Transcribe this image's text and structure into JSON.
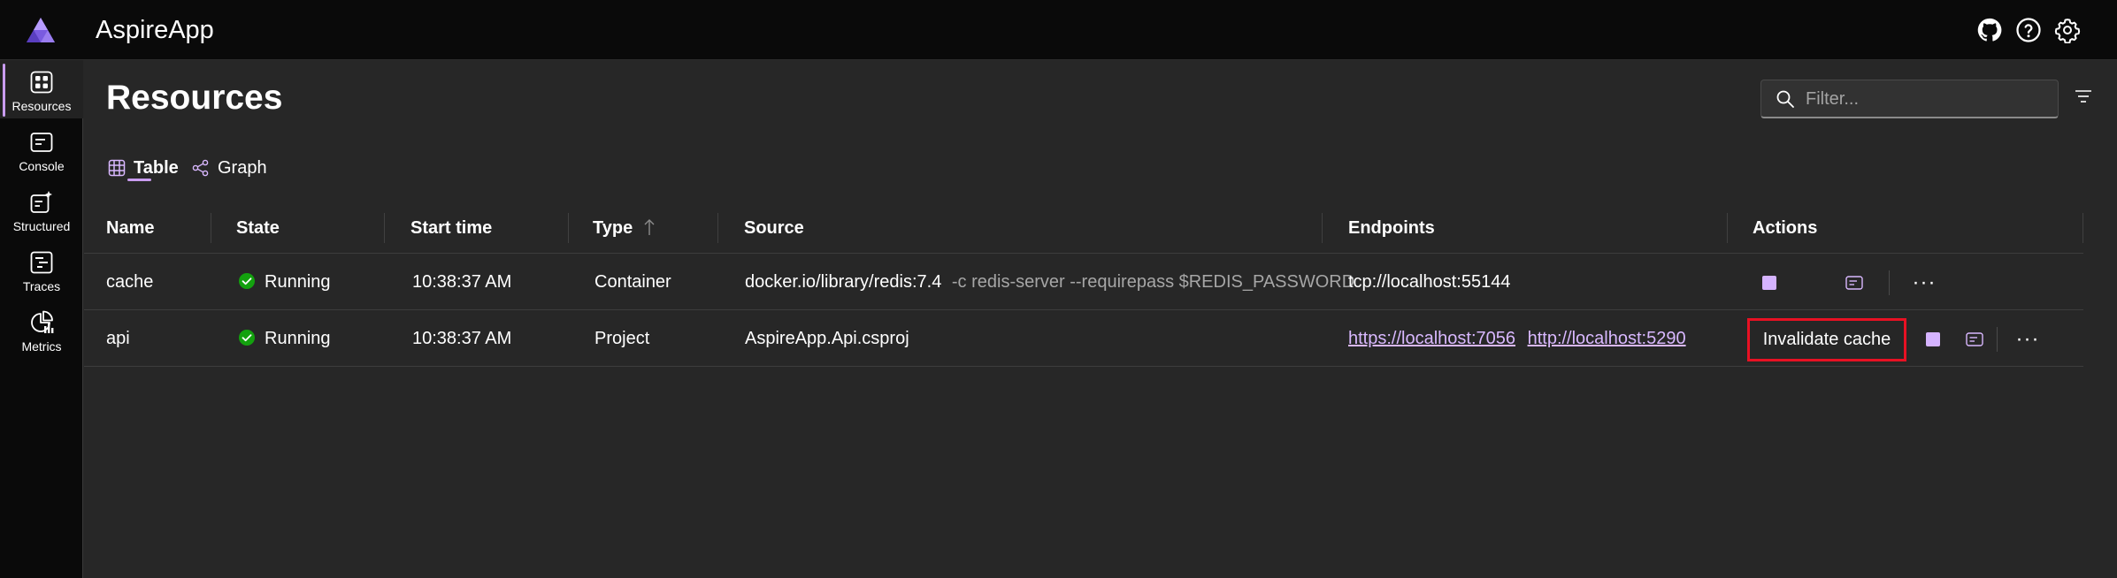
{
  "app": {
    "title": "AspireApp"
  },
  "header_icons": [
    "github-icon",
    "help-icon",
    "settings-icon"
  ],
  "nav": [
    {
      "id": "resources",
      "label": "Resources",
      "icon": "resources-icon",
      "active": true
    },
    {
      "id": "console",
      "label": "Console",
      "icon": "console-icon"
    },
    {
      "id": "structured",
      "label": "Structured",
      "icon": "structured-icon"
    },
    {
      "id": "traces",
      "label": "Traces",
      "icon": "traces-icon"
    },
    {
      "id": "metrics",
      "label": "Metrics",
      "icon": "metrics-icon"
    }
  ],
  "page": {
    "title": "Resources"
  },
  "filter": {
    "placeholder": "Filter..."
  },
  "tabs": [
    {
      "label": "Table",
      "active": true
    },
    {
      "label": "Graph"
    }
  ],
  "table": {
    "columns": [
      "Name",
      "State",
      "Start time",
      "Type",
      "Source",
      "Endpoints",
      "Actions"
    ],
    "rows": [
      {
        "name": "cache",
        "state": "Running",
        "start_time": "10:38:37 AM",
        "type": "Container",
        "source": "docker.io/library/redis:7.4",
        "source_args": "-c redis-server --requirepass $REDIS_PASSWORD",
        "endpoints": [
          "tcp://localhost:55144"
        ]
      },
      {
        "name": "api",
        "state": "Running",
        "start_time": "10:38:37 AM",
        "type": "Project",
        "source": "AspireApp.Api.csproj",
        "source_args": "",
        "endpoints": [
          "https://localhost:7056",
          "http://localhost:5290"
        ],
        "custom_action": "Invalidate cache"
      }
    ]
  },
  "colors": {
    "accent": "#c99cf0",
    "link": "#d9b8ff",
    "running": "#13a10e",
    "highlight": "#e81123",
    "background": "#272727",
    "chrome": "#0a0a0a"
  }
}
